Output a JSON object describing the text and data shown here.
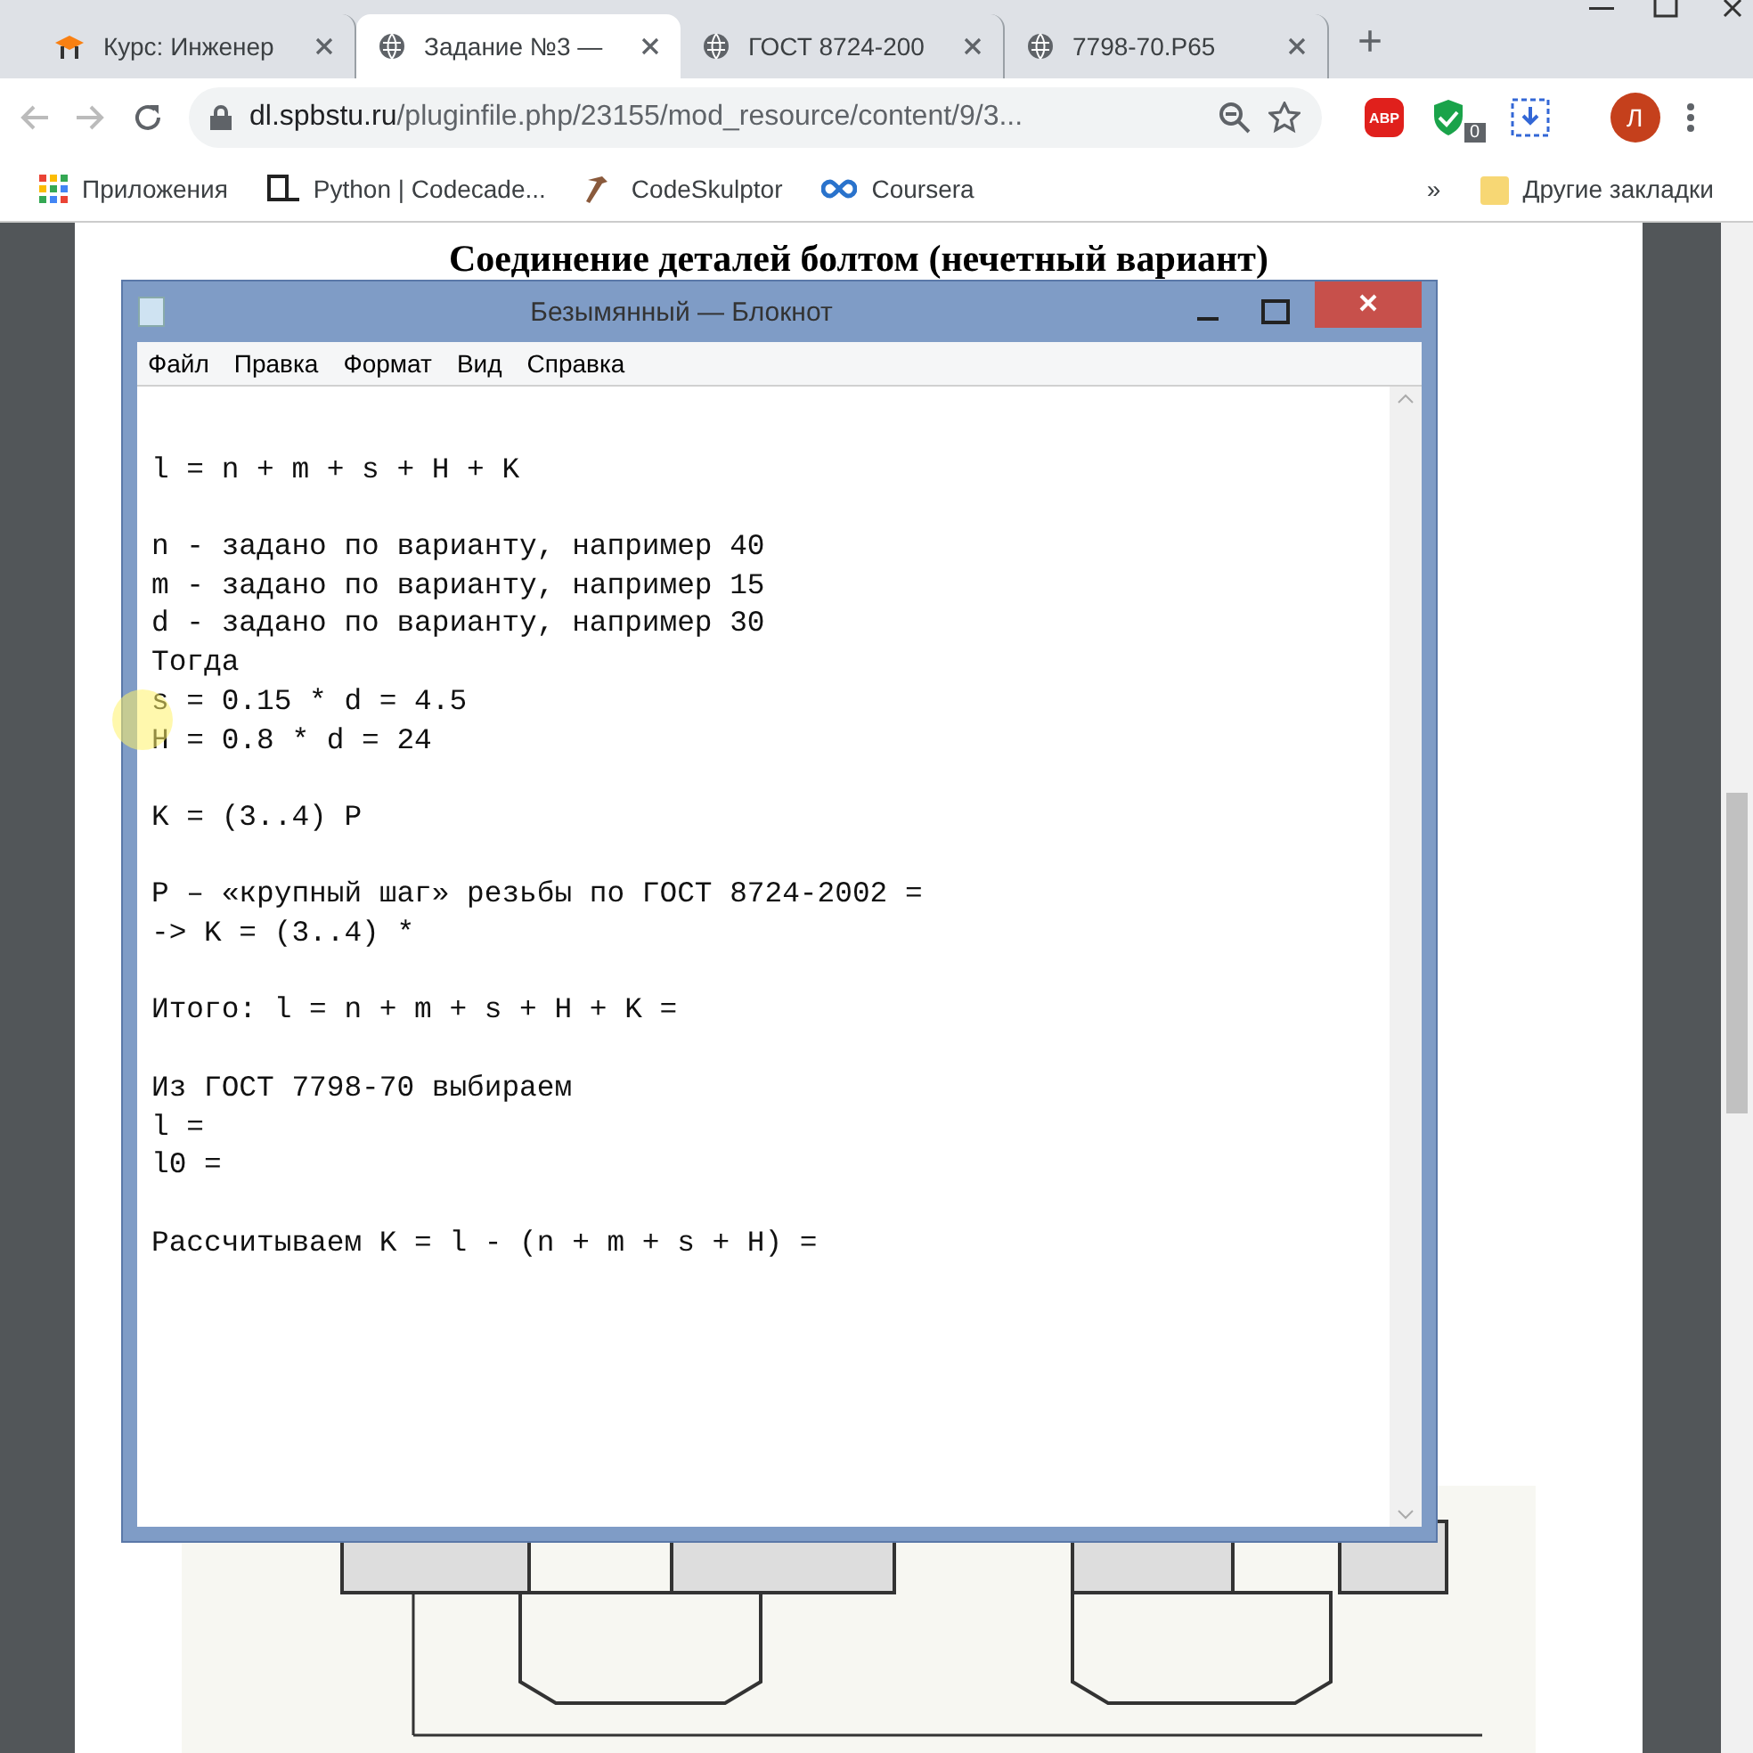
{
  "browser": {
    "tabs": [
      {
        "title": "Курс: Инженер",
        "selected": false
      },
      {
        "title": "Задание №3 —",
        "selected": true
      },
      {
        "title": "ГОСТ 8724-200",
        "selected": false
      },
      {
        "title": "7798-70.P65",
        "selected": false
      }
    ],
    "new_tab": "+",
    "address": {
      "host": "dl.spbstu.ru",
      "path": "/pluginfile.php/23155/mod_resource/content/9/3..."
    },
    "extensions": {
      "adblock": "ABP",
      "badge": "0",
      "profile": "Л"
    },
    "bookmarks": [
      {
        "label": "Приложения"
      },
      {
        "label": "Python | Codecade..."
      },
      {
        "label": "CodeSkulptor"
      },
      {
        "label": "Coursera"
      }
    ],
    "more_bookmarks": "»",
    "other_bookmarks": "Другие закладки"
  },
  "document": {
    "heading": "Соединение деталей болтом (нечетный вариант)"
  },
  "notepad": {
    "title": "Безымянный — Блокнот",
    "menu": [
      "Файл",
      "Правка",
      "Формат",
      "Вид",
      "Справка"
    ],
    "paragraphs": [
      [
        "l = n + m + s + H + K"
      ],
      [
        "n - задано по варианту, например 40",
        "m - задано по варианту, например 15",
        "d - задано по варианту, например 30",
        "Тогда",
        "s = 0.15 * d = 4.5",
        "H = 0.8 * d = 24"
      ],
      [
        "K = (3..4) P"
      ],
      [
        "P – «крупный шаг» резьбы по ГОСТ 8724-2002 =",
        "-> K = (3..4) *"
      ],
      [
        "Итого: l = n + m + s + H + K ="
      ],
      [
        "Из ГОСТ 7798-70 выбираем",
        "l =",
        "l0 ="
      ],
      [
        "Рассчитываем K = l - (n + m + s + H) ="
      ]
    ]
  }
}
